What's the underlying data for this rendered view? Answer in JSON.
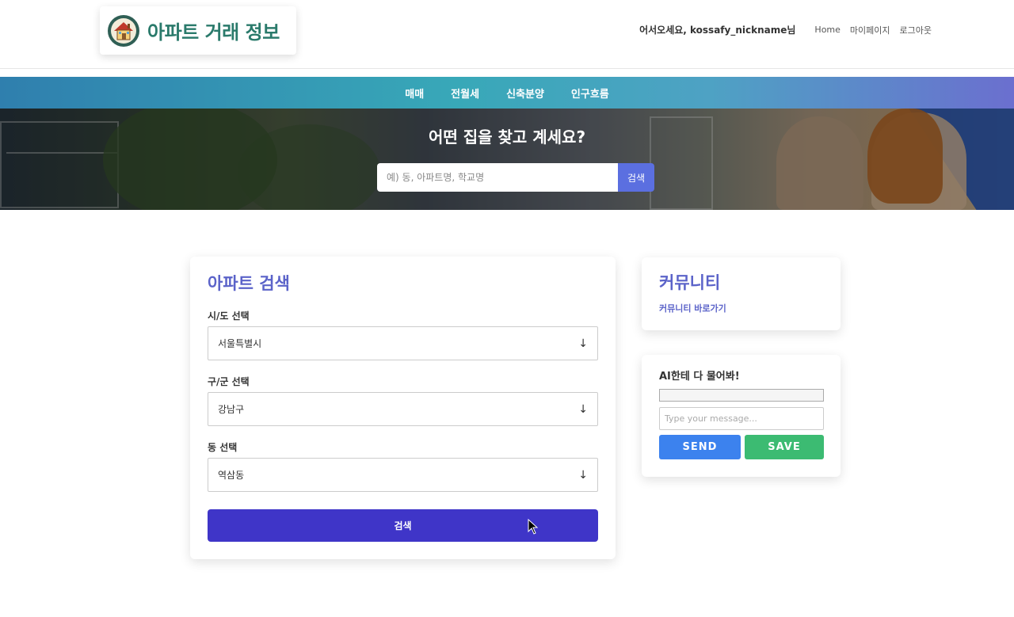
{
  "header": {
    "logo_title": "아파트 거래 정보",
    "greeting": "어서오세요, kossafy_nickname님",
    "nav": [
      {
        "label": "Home"
      },
      {
        "label": "마이페이지"
      },
      {
        "label": "로그아웃"
      }
    ]
  },
  "category_nav": [
    {
      "label": "매매"
    },
    {
      "label": "전월세"
    },
    {
      "label": "신축분양"
    },
    {
      "label": "인구흐름"
    }
  ],
  "hero": {
    "title": "어떤 집을 찾고 계세요?",
    "search_placeholder": "예) 동, 아파트명, 학교명",
    "search_button": "검색"
  },
  "search_card": {
    "title": "아파트 검색",
    "fields": [
      {
        "label": "시/도 선택",
        "value": "서울특별시"
      },
      {
        "label": "구/군 선택",
        "value": "강남구"
      },
      {
        "label": "동 선택",
        "value": "역삼동"
      }
    ],
    "submit_label": "검색"
  },
  "community": {
    "title": "커뮤니티",
    "link": "커뮤니티 바로가기"
  },
  "ai_chat": {
    "title": "AI한테 다 물어봐!",
    "input_placeholder": "Type your message...",
    "send_label": "SEND",
    "save_label": "SAVE"
  },
  "colors": {
    "brand_teal": "#2a7a6b",
    "accent_indigo": "#5b63c9",
    "primary_button": "#3f35c8",
    "send_button": "#3c82ee",
    "save_button": "#3cbb72"
  }
}
